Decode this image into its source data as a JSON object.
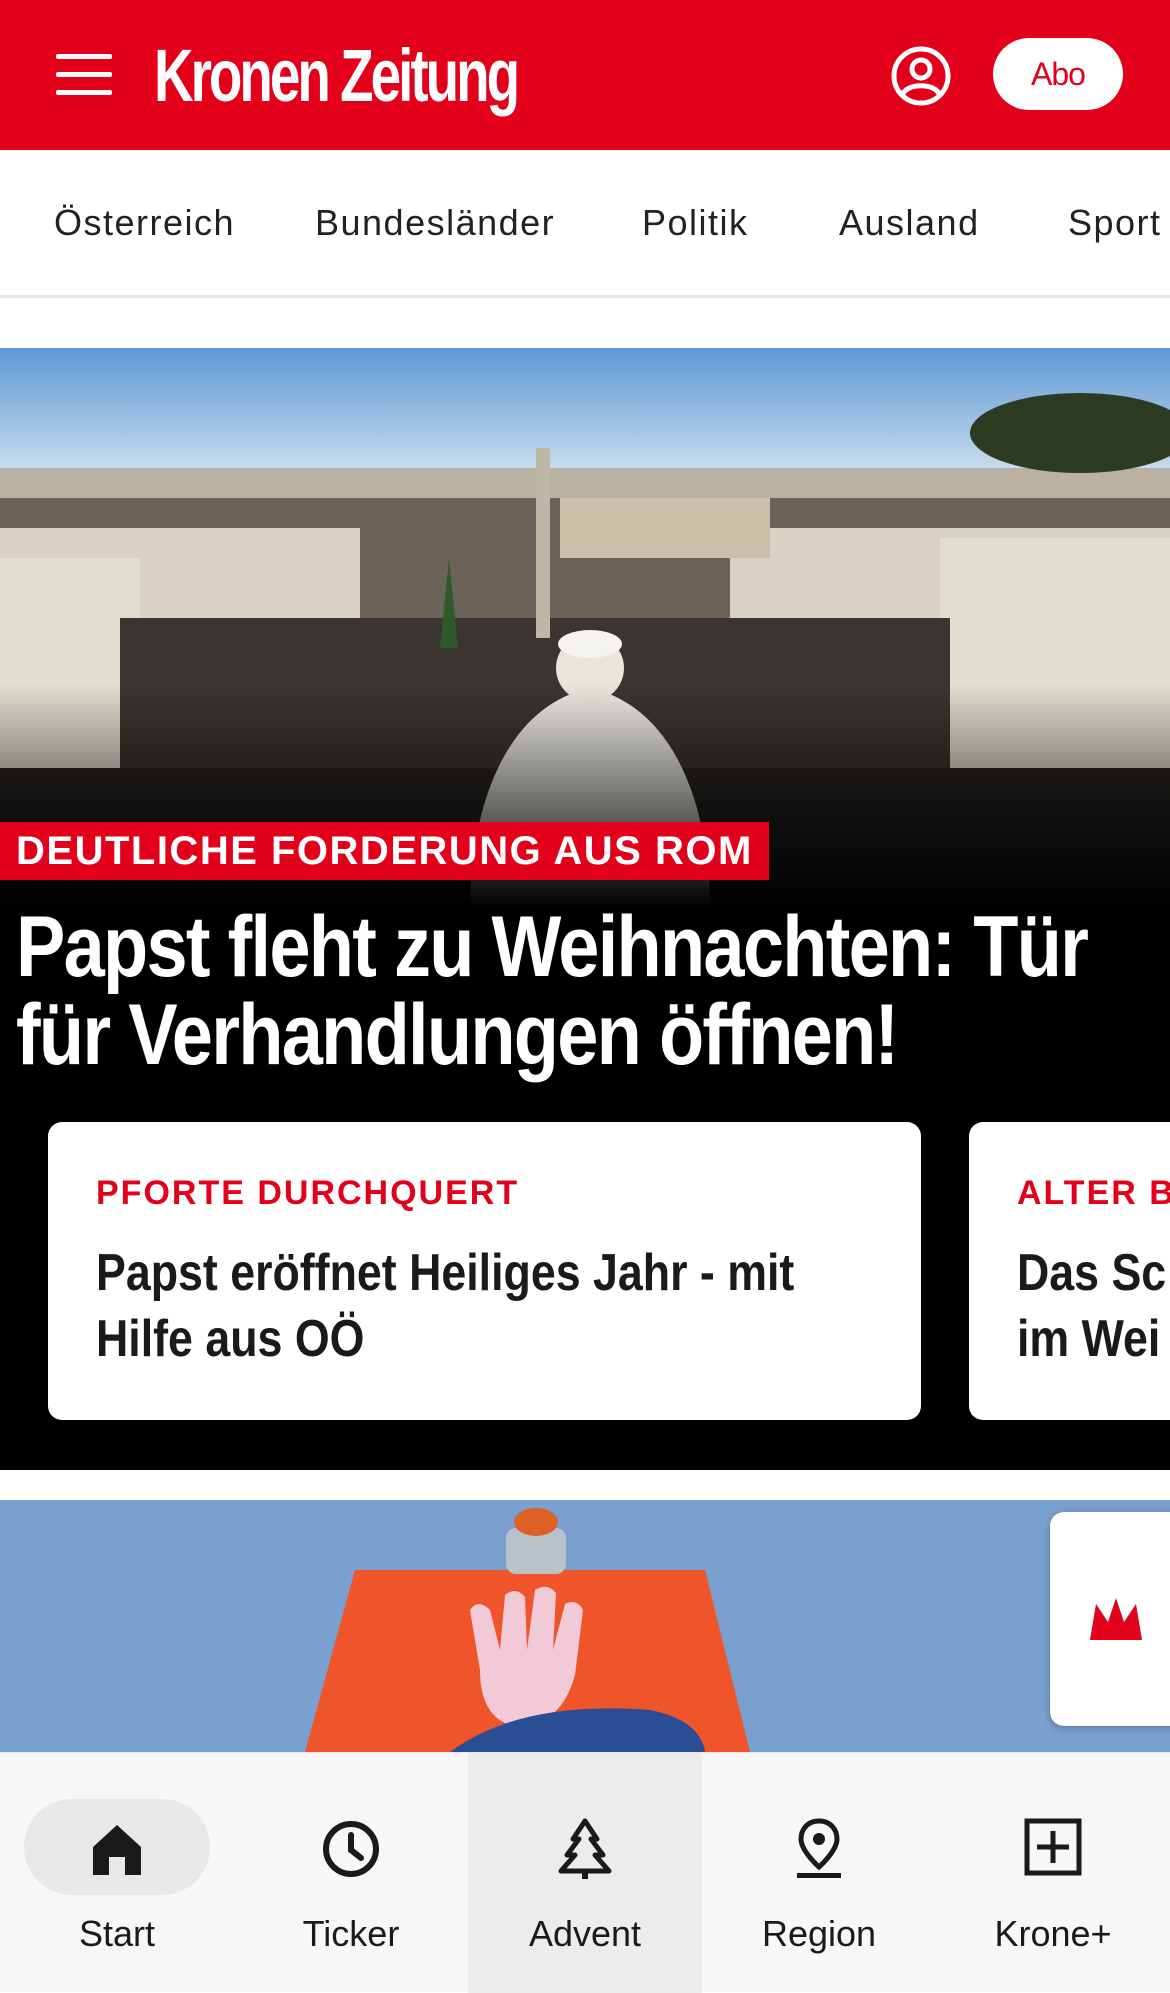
{
  "header": {
    "logo": "Kronen Zeitung",
    "abo_label": "Abo",
    "colors": {
      "brand": "#e2001a",
      "text_on_brand": "#ffffff"
    }
  },
  "nav": {
    "items": [
      "Österreich",
      "Bundesländer",
      "Politik",
      "Ausland",
      "Sport"
    ]
  },
  "hero": {
    "kicker": "DEUTLICHE FORDERUNG AUS ROM",
    "headline": "Papst fleht zu Weihnachten: Tür für Verhandlungen öffnen!",
    "cards": [
      {
        "kicker": "PFORTE DURCHQUERT",
        "title": "Papst eröffnet Heiliges Jahr - mit Hilfe aus OÖ"
      },
      {
        "kicker": "ALTER B",
        "title": "Das Sc im Wei"
      }
    ]
  },
  "bottom_nav": {
    "items": [
      {
        "label": "Start",
        "icon": "home-icon"
      },
      {
        "label": "Ticker",
        "icon": "clock-icon"
      },
      {
        "label": "Advent",
        "icon": "tree-icon"
      },
      {
        "label": "Region",
        "icon": "location-pin-icon"
      },
      {
        "label": "Krone+",
        "icon": "plus-box-icon"
      }
    ]
  }
}
